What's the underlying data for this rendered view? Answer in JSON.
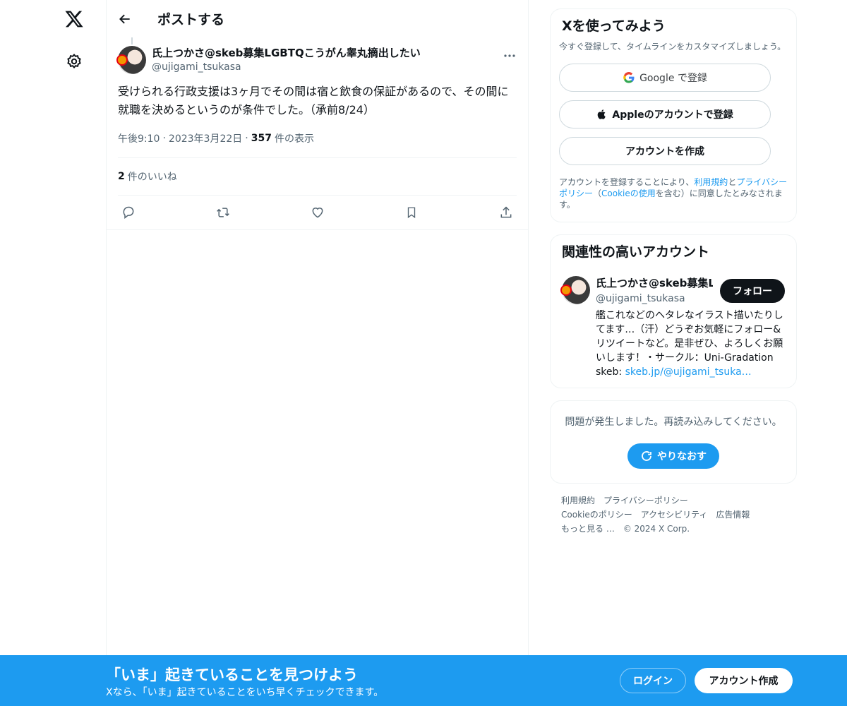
{
  "header": {
    "title": "ポストする"
  },
  "post": {
    "author_name": "氏上つかさ@skeb募集LGBTQこうがん睾丸摘出したい",
    "author_handle": "@ujigami_tsukasa",
    "text": "受けられる行政支援は3ヶ月でその間は宿と飲食の保証があるので、その間に就職を決めるというのが条件でした。（承前8/24）",
    "time": "午後9:10",
    "date": "2023年3月22日",
    "views_count": "357",
    "views_label": "件の表示",
    "likes_count": "2",
    "likes_label": "件のいいね"
  },
  "signup": {
    "title": "Xを使ってみよう",
    "subtitle": "今すぐ登録して、タイムラインをカスタマイズしましょう。",
    "google_label": "Google で登録",
    "apple_label": "Appleのアカウントで登録",
    "create_label": "アカウントを作成",
    "legal_1": "アカウントを登録することにより、",
    "legal_terms": "利用規約",
    "legal_2": "と",
    "legal_privacy": "プライバシーポリシー",
    "legal_3": "（",
    "legal_cookie": "Cookieの使用",
    "legal_4": "を含む）に同意したとみなされます。"
  },
  "related": {
    "title": "関連性の高いアカウント",
    "name": "氏上つかさ@skeb募集LGBTQこうがん睾丸摘出したい",
    "handle": "@ujigami_tsukasa",
    "bio": "艦これなどのヘタレなイラスト描いたりしてます…（汗）どうぞお気軽にフォロー&リツイートなど。是非ぜひ、よろしくお願いします！・サークル：Uni-Gradation skeb:",
    "bio_link": "skeb.jp/@ujigami_tsuka…",
    "follow_label": "フォロー"
  },
  "error": {
    "message": "問題が発生しました。再読み込みしてください。",
    "retry_label": "やりなおす"
  },
  "footer": {
    "terms": "利用規約",
    "privacy": "プライバシーポリシー",
    "cookie": "Cookieのポリシー",
    "accessibility": "アクセシビリティ",
    "ads": "広告情報",
    "more": "もっと見る …",
    "copyright": "© 2024 X Corp."
  },
  "bottombar": {
    "title": "「いま」起きていることを見つけよう",
    "subtitle": "Xなら、「いま」起きていることをいち早くチェックできます。",
    "login_label": "ログイン",
    "signup_label": "アカウント作成"
  },
  "colors": {
    "accent": "#1d9bf0",
    "text": "#0f1419",
    "muted": "#536471"
  }
}
